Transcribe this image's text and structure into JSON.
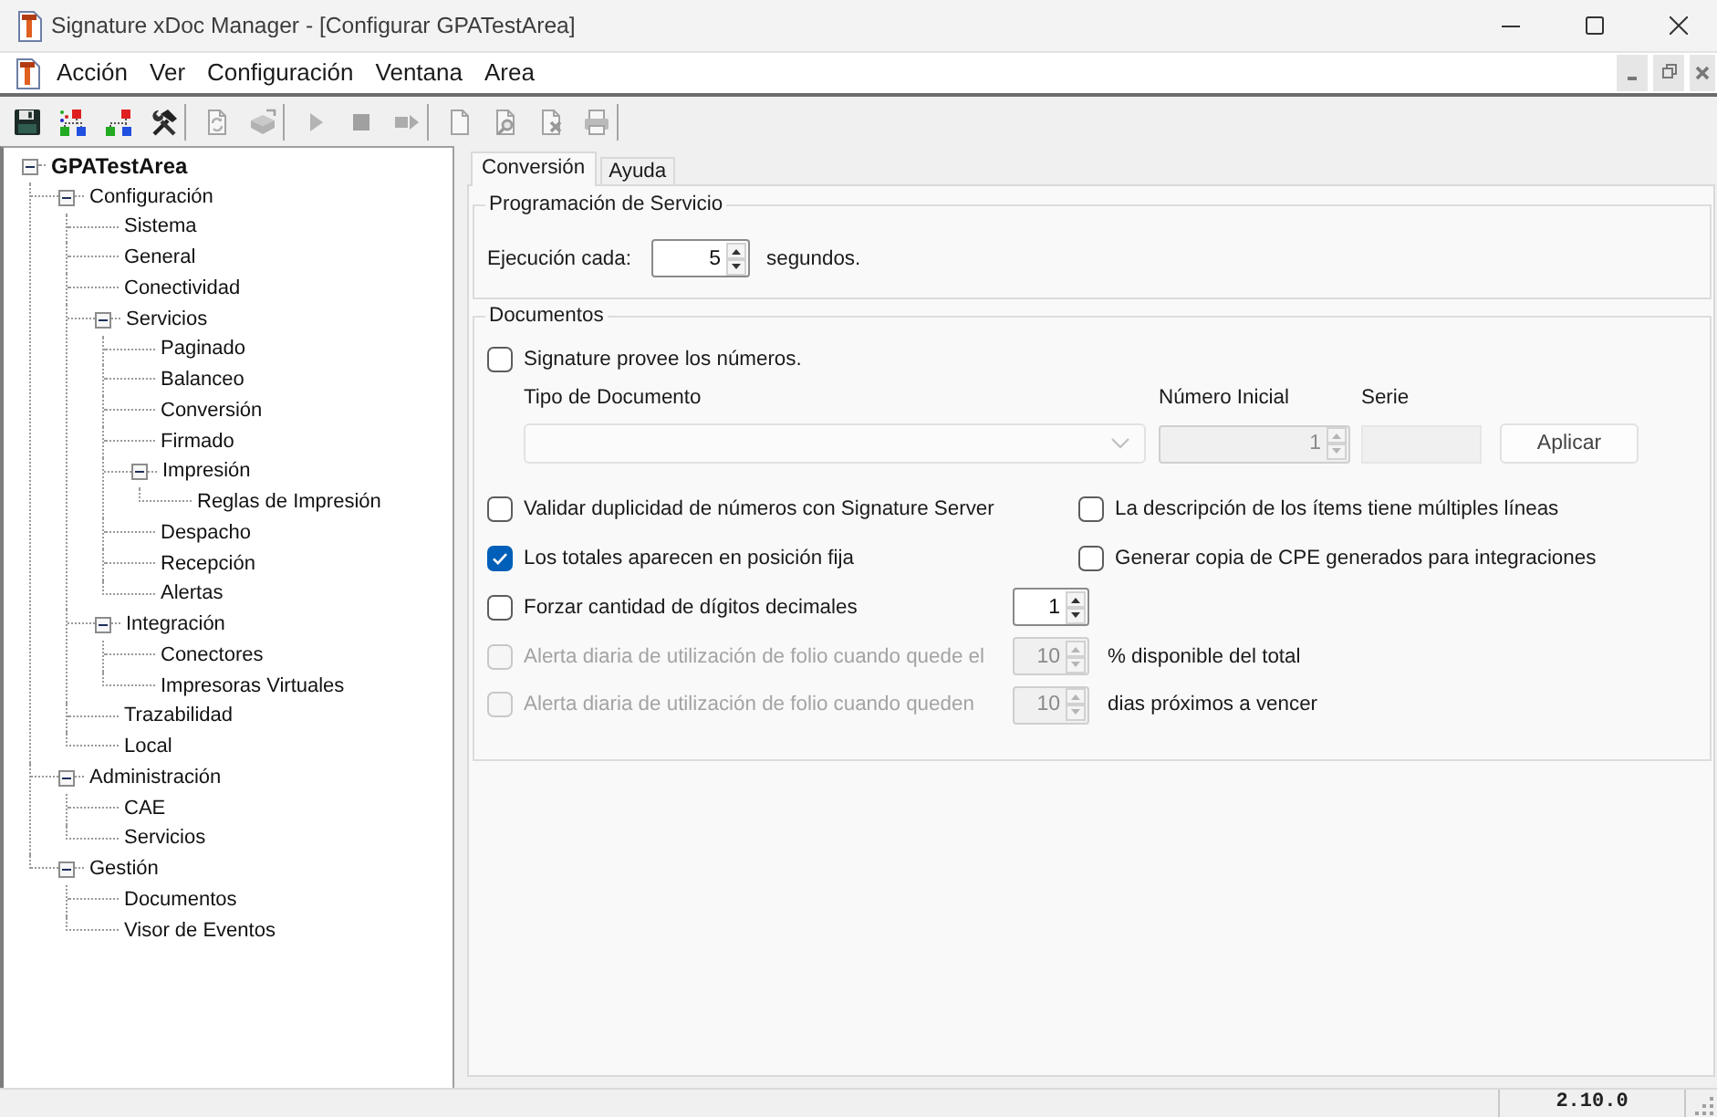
{
  "window": {
    "title": "Signature xDoc Manager - [Configurar GPATestArea]"
  },
  "menu_bar": {
    "items": [
      "Acción",
      "Ver",
      "Configuración",
      "Ventana",
      "Area"
    ]
  },
  "toolbar": {
    "groups": [
      [
        {
          "disabled": false
        },
        {
          "disabled": false
        },
        {
          "disabled": false
        },
        {
          "disabled": false
        }
      ],
      [
        {
          "disabled": true
        },
        {
          "disabled": true
        }
      ],
      [
        {
          "disabled": true
        },
        {
          "disabled": true
        },
        {
          "disabled": true
        }
      ],
      [
        {
          "disabled": true
        },
        {
          "disabled": true
        },
        {
          "disabled": true
        },
        {
          "disabled": true
        }
      ]
    ]
  },
  "tree": {
    "items": [
      {
        "label": "GPATestArea",
        "selected": false,
        "expanded": true,
        "children": [
          {
            "label": "Configuración",
            "selected": false,
            "expanded": true,
            "children": [
              {
                "label": "Sistema",
                "selected": false
              },
              {
                "label": "General",
                "selected": false
              },
              {
                "label": "Conectividad",
                "selected": false
              },
              {
                "label": "Servicios",
                "selected": false,
                "expanded": true,
                "children": [
                  {
                    "label": "Paginado",
                    "selected": false
                  },
                  {
                    "label": "Balanceo",
                    "selected": false
                  },
                  {
                    "label": "Conversión",
                    "selected": false
                  },
                  {
                    "label": "Firmado",
                    "selected": false
                  },
                  {
                    "label": "Impresión",
                    "selected": false,
                    "expanded": true,
                    "children": [
                      {
                        "label": "Reglas de Impresión",
                        "selected": false
                      }
                    ]
                  },
                  {
                    "label": "Despacho",
                    "selected": false
                  },
                  {
                    "label": "Recepción",
                    "selected": false
                  },
                  {
                    "label": "Alertas",
                    "selected": false
                  }
                ]
              },
              {
                "label": "Integración",
                "selected": false,
                "expanded": true,
                "children": [
                  {
                    "label": "Conectores",
                    "selected": false
                  },
                  {
                    "label": "Impresoras Virtuales",
                    "selected": false
                  }
                ]
              },
              {
                "label": "Trazabilidad",
                "selected": false
              },
              {
                "label": "Local",
                "selected": false
              }
            ]
          },
          {
            "label": "Administración",
            "selected": false,
            "expanded": true,
            "children": [
              {
                "label": "CAE",
                "selected": false
              },
              {
                "label": "Servicios",
                "selected": false
              }
            ]
          },
          {
            "label": "Gestión",
            "selected": false,
            "expanded": true,
            "children": [
              {
                "label": "Documentos",
                "selected": false
              },
              {
                "label": "Visor de Eventos",
                "selected": false
              }
            ]
          }
        ]
      }
    ]
  },
  "tabs": [
    {
      "label": "Conversión",
      "selected": true
    },
    {
      "label": "Ayuda",
      "selected": false
    }
  ],
  "service_group": {
    "title": "Programación de Servicio",
    "label": "Ejecución cada:",
    "value": "5",
    "unit": "segundos."
  },
  "documents_group": {
    "title": "Documentos",
    "provider_option": {
      "label": "Signature provee los números.",
      "checked": false,
      "disabled": false
    },
    "document_type": {
      "label": "Tipo de Documento",
      "disabled": true
    },
    "initial_number": {
      "label": "Número Inicial",
      "value": "1",
      "disabled": true
    },
    "series": {
      "label": "Serie",
      "disabled": true
    },
    "apply_button": {
      "label": "Aplicar"
    },
    "options": [
      {
        "kind": "pair",
        "items": [
          {
            "label": "Validar duplicidad de números con Signature Server",
            "checked": false,
            "disabled": false
          },
          {
            "label": "La descripción de los ítems tiene múltiples líneas",
            "checked": false,
            "disabled": false
          }
        ]
      },
      {
        "kind": "pair",
        "items": [
          {
            "label": "Los totales aparecen en posición fija",
            "checked": true,
            "disabled": false
          },
          {
            "label": "Generar copia de CPE generados para integraciones",
            "checked": false,
            "disabled": false
          }
        ]
      },
      {
        "kind": "spinner",
        "label": "Forzar cantidad de dígitos decimales",
        "checked": false,
        "disabled": false,
        "value": "1"
      },
      {
        "kind": "spinner",
        "label": "Alerta diaria de utilización de folio cuando quede el",
        "checked": false,
        "disabled": true,
        "value": "10",
        "suffix": "% disponible del total"
      },
      {
        "kind": "spinner",
        "label": "Alerta diaria de utilización de folio cuando queden",
        "checked": false,
        "disabled": true,
        "value": "10",
        "suffix": "dias próximos a vencer"
      }
    ]
  },
  "status_bar": {
    "version": "2.10.0"
  }
}
